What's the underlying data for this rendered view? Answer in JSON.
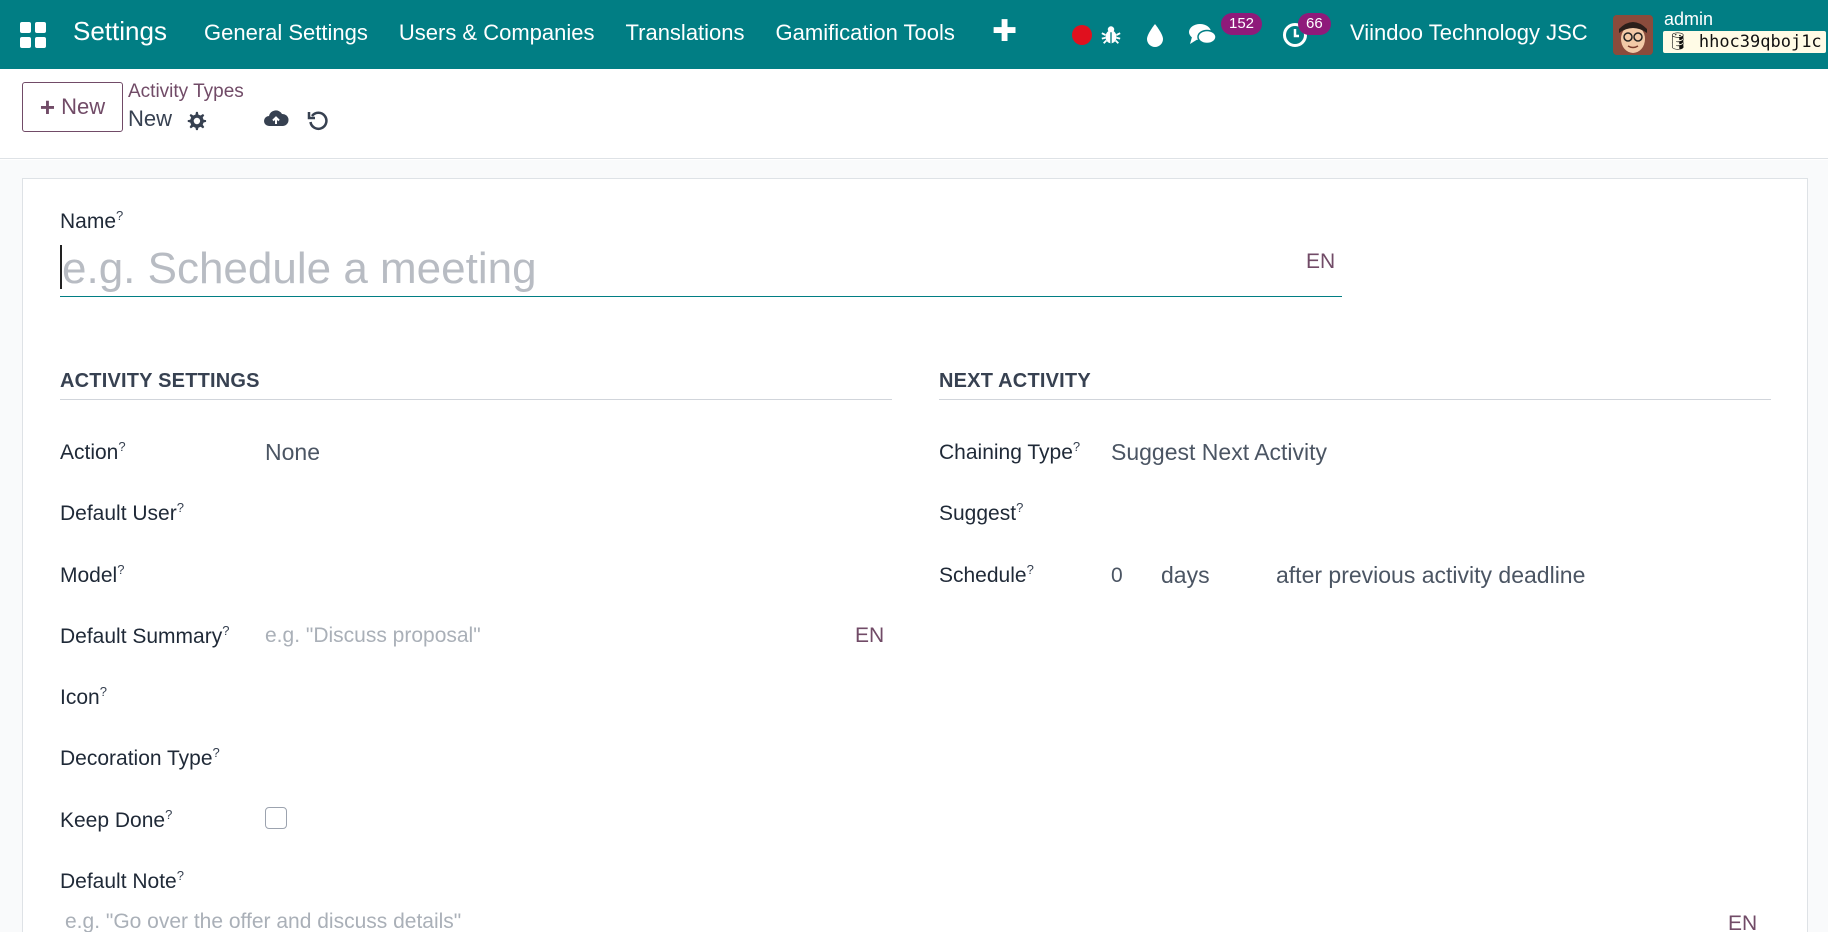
{
  "navbar": {
    "app_title": "Settings",
    "menu": [
      "General Settings",
      "Users & Companies",
      "Translations",
      "Gamification Tools"
    ],
    "messages_count": "152",
    "activities_count": "66",
    "company": "Viindoo Technology JSC",
    "user_name": "admin",
    "database": "hhoc39qboj1c"
  },
  "control_panel": {
    "new_label": "New",
    "breadcrumb_parent": "Activity Types",
    "breadcrumb_current": "New"
  },
  "form": {
    "name_label": "Name",
    "name_placeholder": "e.g. Schedule a meeting",
    "lang_tag": "EN",
    "help_mark": "?",
    "activity_settings": {
      "title": "ACTIVITY SETTINGS",
      "action_label": "Action",
      "action_value": "None",
      "default_user_label": "Default User",
      "model_label": "Model",
      "default_summary_label": "Default Summary",
      "default_summary_placeholder": "e.g. \"Discuss proposal\"",
      "icon_label": "Icon",
      "decoration_type_label": "Decoration Type",
      "keep_done_label": "Keep Done",
      "default_note_label": "Default Note",
      "default_note_placeholder": "e.g. \"Go over the offer and discuss details\""
    },
    "next_activity": {
      "title": "NEXT ACTIVITY",
      "chaining_type_label": "Chaining Type",
      "chaining_type_value": "Suggest Next Activity",
      "suggest_label": "Suggest",
      "schedule_label": "Schedule",
      "schedule_value": "0",
      "schedule_unit": "days",
      "schedule_from": "after previous activity deadline"
    }
  },
  "colors": {
    "navbar": "#017e84",
    "accent": "#714b67",
    "badge": "#8f1a7a",
    "record": "#e0101e"
  }
}
